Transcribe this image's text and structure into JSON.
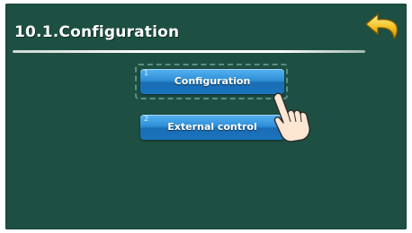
{
  "header": {
    "title": "10.1.Configuration",
    "back_icon": "back-arrow-icon"
  },
  "menu": {
    "items": [
      {
        "number": "1",
        "label": "Configuration",
        "selected": true
      },
      {
        "number": "2",
        "label": "External control",
        "selected": false
      }
    ]
  },
  "pointer_icon": "pointing-hand-icon",
  "colors": {
    "background": "#1d4f43",
    "button": "#2f8fd6",
    "back_arrow": "#f2c21c"
  }
}
